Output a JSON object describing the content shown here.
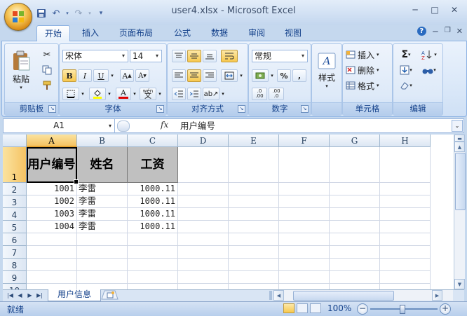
{
  "window": {
    "title": "user4.xlsx - Microsoft Excel",
    "controls": {
      "minimize": "─",
      "maximize": "□",
      "close": "✕"
    }
  },
  "qat": {
    "icons": [
      "save-icon",
      "undo-icon",
      "redo-icon",
      "customize-qat-icon"
    ]
  },
  "tabs": [
    {
      "label": "开始",
      "active": true
    },
    {
      "label": "插入"
    },
    {
      "label": "页面布局"
    },
    {
      "label": "公式"
    },
    {
      "label": "数据"
    },
    {
      "label": "审阅"
    },
    {
      "label": "视图"
    }
  ],
  "ribbon": {
    "clipboard": {
      "label": "剪贴板",
      "paste": "粘贴"
    },
    "font": {
      "label": "字体",
      "name": "宋体",
      "size": "14",
      "bold": "B",
      "italic": "I",
      "underline": "U",
      "grow": "A",
      "shrink": "A",
      "phonetic": "wén",
      "phonetic_char": "文"
    },
    "alignment": {
      "label": "对齐方式"
    },
    "number": {
      "label": "数字",
      "format": "常规",
      "percent": "%",
      "comma": ",",
      "inc_decimal": ".0 .00",
      "dec_decimal": ".00 .0"
    },
    "styles": {
      "label": "样式"
    },
    "cells": {
      "label": "单元格",
      "insert": "插入",
      "delete": "删除",
      "format": "格式"
    },
    "editing": {
      "label": "编辑"
    }
  },
  "formula_bar": {
    "name_box": "A1",
    "fx": "fx",
    "content": "用户编号"
  },
  "grid": {
    "columns": [
      "A",
      "B",
      "C",
      "D",
      "E",
      "F",
      "G",
      "H"
    ],
    "rows": [
      "1",
      "2",
      "3",
      "4",
      "5",
      "6",
      "7",
      "8",
      "9",
      "10"
    ],
    "header_row": [
      "用户编号",
      "姓名",
      "工资"
    ],
    "data": [
      [
        "1001",
        "李雷",
        "1000.11"
      ],
      [
        "1002",
        "李雷",
        "1000.11"
      ],
      [
        "1003",
        "李雷",
        "1000.11"
      ],
      [
        "1004",
        "李雷",
        "1000.11"
      ]
    ],
    "selected_cell": "A1"
  },
  "sheets": {
    "tabs": [
      "用户信息"
    ]
  },
  "status": {
    "text": "就绪",
    "zoom": "100%",
    "zoom_out": "−",
    "zoom_in": "+"
  },
  "colors": {
    "ribbon": "#dce9f9",
    "accent": "#15428b",
    "header_fill": "#c0c0c0",
    "selection": "#f5c363"
  }
}
